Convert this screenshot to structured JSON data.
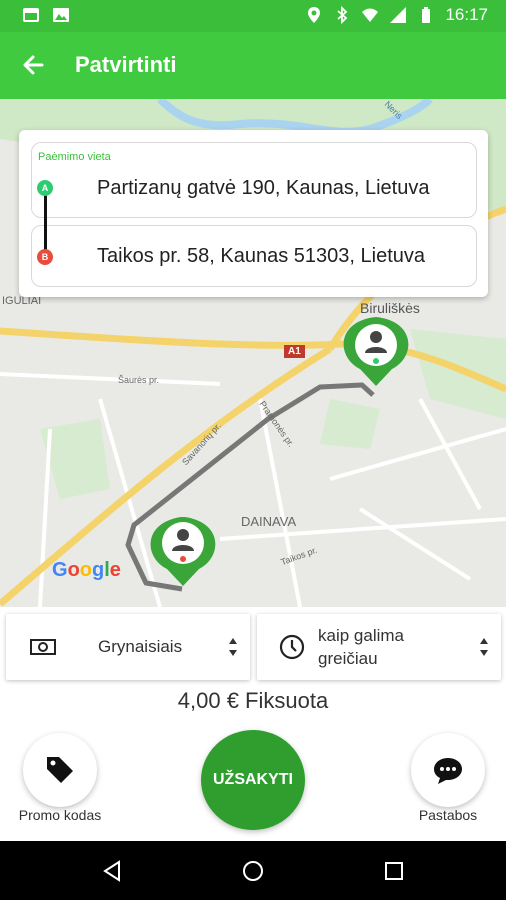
{
  "status_bar": {
    "time": "16:17"
  },
  "app_bar": {
    "title": "Patvirtinti"
  },
  "map": {
    "labels": {
      "biruliskes": "Biruliškės",
      "dainava": "DAINAVA",
      "iguliai": "IGULIAI",
      "road_a1": "A1",
      "savanoriu": "Savanorių pr.",
      "pramones": "Pramonės pr.",
      "sauros": "Šaurės pr.",
      "taikos": "Taikos pr.",
      "neris": "Neris"
    },
    "google": [
      "G",
      "o",
      "o",
      "g",
      "l",
      "e"
    ]
  },
  "addresses": {
    "pickup_label": "Paėmimo vieta",
    "from_marker": "A",
    "to_marker": "B",
    "from": "Partizanų gatvė 190, Kaunas, Lietuva",
    "to": "Taikos pr. 58, Kaunas 51303, Lietuva"
  },
  "payment": {
    "label": "Grynaisiais",
    "icon": "cash-icon"
  },
  "time_select": {
    "line1": "kaip galima",
    "line2": "greičiau",
    "icon": "clock-icon"
  },
  "price": "4,00 € Fiksuota",
  "buttons": {
    "promo": "Promo kodas",
    "order": "UŽSAKYTI",
    "notes": "Pastabos"
  },
  "colors": {
    "primary": "#3fca3f",
    "order": "#2f9e2f",
    "marker_a": "#2ecc71",
    "marker_b": "#e74c3c"
  }
}
